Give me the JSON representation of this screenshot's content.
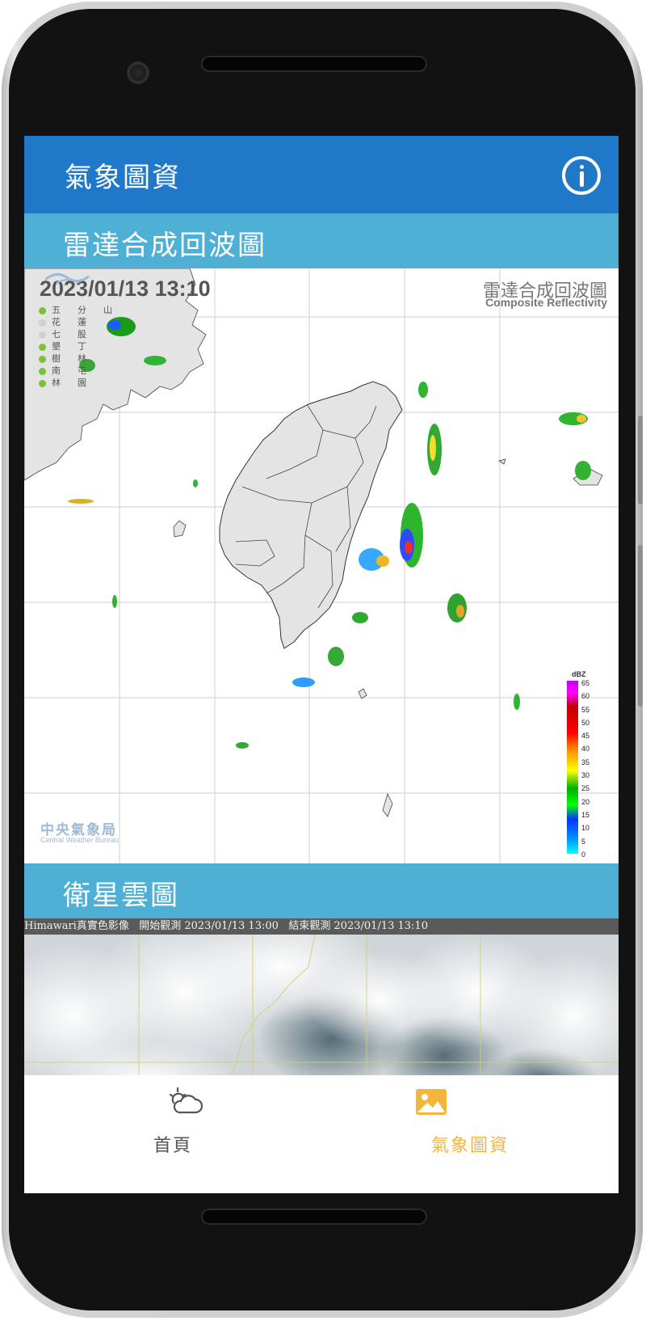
{
  "app_bar": {
    "title": "氣象圖資",
    "info_icon": "info-icon"
  },
  "radar_section": {
    "title": "雷達合成回波圖",
    "timestamp": "2023/01/13  13:10",
    "title_cn": "雷達合成回波圖",
    "title_en": "Composite Reflectivity",
    "stations": [
      {
        "label": "五分山",
        "status_color": "#7cbf3a"
      },
      {
        "label": "花蓮",
        "status_color": "#d0d0d0"
      },
      {
        "label": "七股",
        "status_color": "#d0d0d0"
      },
      {
        "label": "墾丁",
        "status_color": "#7cbf3a"
      },
      {
        "label": "樹林",
        "status_color": "#7cbf3a"
      },
      {
        "label": "南屯",
        "status_color": "#7cbf3a"
      },
      {
        "label": "林園",
        "status_color": "#7cbf3a"
      }
    ],
    "agency_cn": "中央氣象局",
    "agency_en": "Central Weather Bureau",
    "legend_unit": "dBZ",
    "legend_ticks": [
      "65",
      "60",
      "55",
      "50",
      "45",
      "40",
      "35",
      "30",
      "25",
      "20",
      "15",
      "10",
      "5",
      "0"
    ]
  },
  "satellite_section": {
    "title": "衛星雲圖",
    "caption_source": "Himawari真實色影像",
    "caption_start": "開始觀測 2023/01/13 13:00",
    "caption_end": "結束觀測 2023/01/13 13:10"
  },
  "bottom_nav": {
    "items": [
      {
        "label": "首頁",
        "icon": "weather-cloud-sun-icon",
        "active": false
      },
      {
        "label": "氣象圖資",
        "icon": "image-icon",
        "active": true
      }
    ],
    "active_color": "#f3b63a",
    "inactive_color": "#555555"
  },
  "colors": {
    "app_bar": "#1f78c8",
    "section_header": "#4fb0d6"
  }
}
